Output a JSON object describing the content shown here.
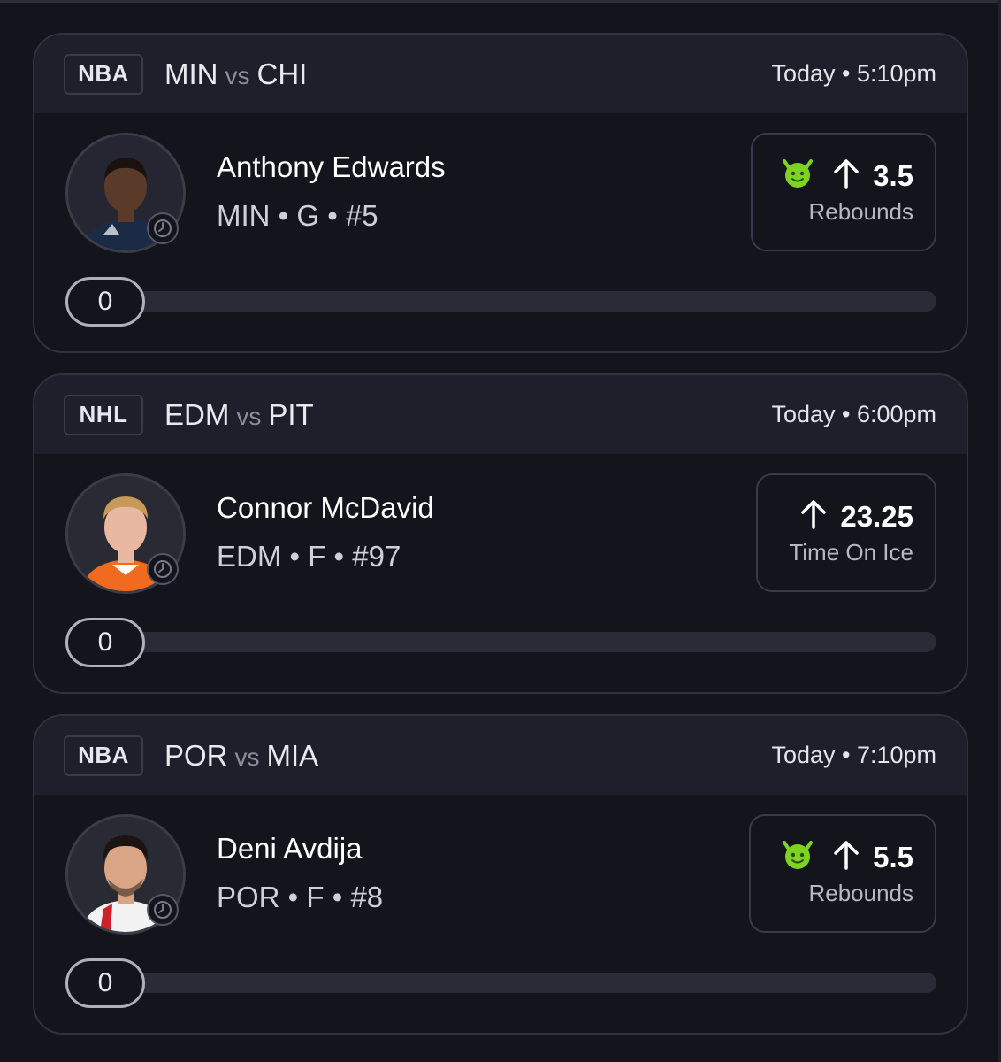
{
  "cards": [
    {
      "league": "NBA",
      "team_home": "MIN",
      "vs": "vs",
      "team_away": "CHI",
      "time": "Today • 5:10pm",
      "player_name": "Anthony Edwards",
      "player_meta": "MIN • G • #5",
      "line_value": "3.5",
      "line_stat": "Rebounds",
      "has_demon": true,
      "direction": "up",
      "progress_value": "0",
      "progress_fraction": 0,
      "colors": {
        "skin": "#5a3a28",
        "hair": "#1a1210",
        "jersey": "#1b2a45"
      }
    },
    {
      "league": "NHL",
      "team_home": "EDM",
      "vs": "vs",
      "team_away": "PIT",
      "time": "Today • 6:00pm",
      "player_name": "Connor McDavid",
      "player_meta": "EDM • F • #97",
      "line_value": "23.25",
      "line_stat": "Time On Ice",
      "has_demon": false,
      "direction": "up",
      "progress_value": "0",
      "progress_fraction": 0,
      "colors": {
        "skin": "#e8b9a0",
        "hair": "#c89a5a",
        "jersey": "#f06a20"
      }
    },
    {
      "league": "NBA",
      "team_home": "POR",
      "vs": "vs",
      "team_away": "MIA",
      "time": "Today • 7:10pm",
      "player_name": "Deni Avdija",
      "player_meta": "POR • F • #8",
      "line_value": "5.5",
      "line_stat": "Rebounds",
      "has_demon": true,
      "direction": "up",
      "progress_value": "0",
      "progress_fraction": 0,
      "colors": {
        "skin": "#d9a585",
        "hair": "#1c1410",
        "jersey": "#f2f2f2"
      }
    }
  ],
  "theme": {
    "background": "#14141d",
    "header_bg": "#1f1f2b",
    "border": "#32323e",
    "demon_green": "#7ed321"
  }
}
